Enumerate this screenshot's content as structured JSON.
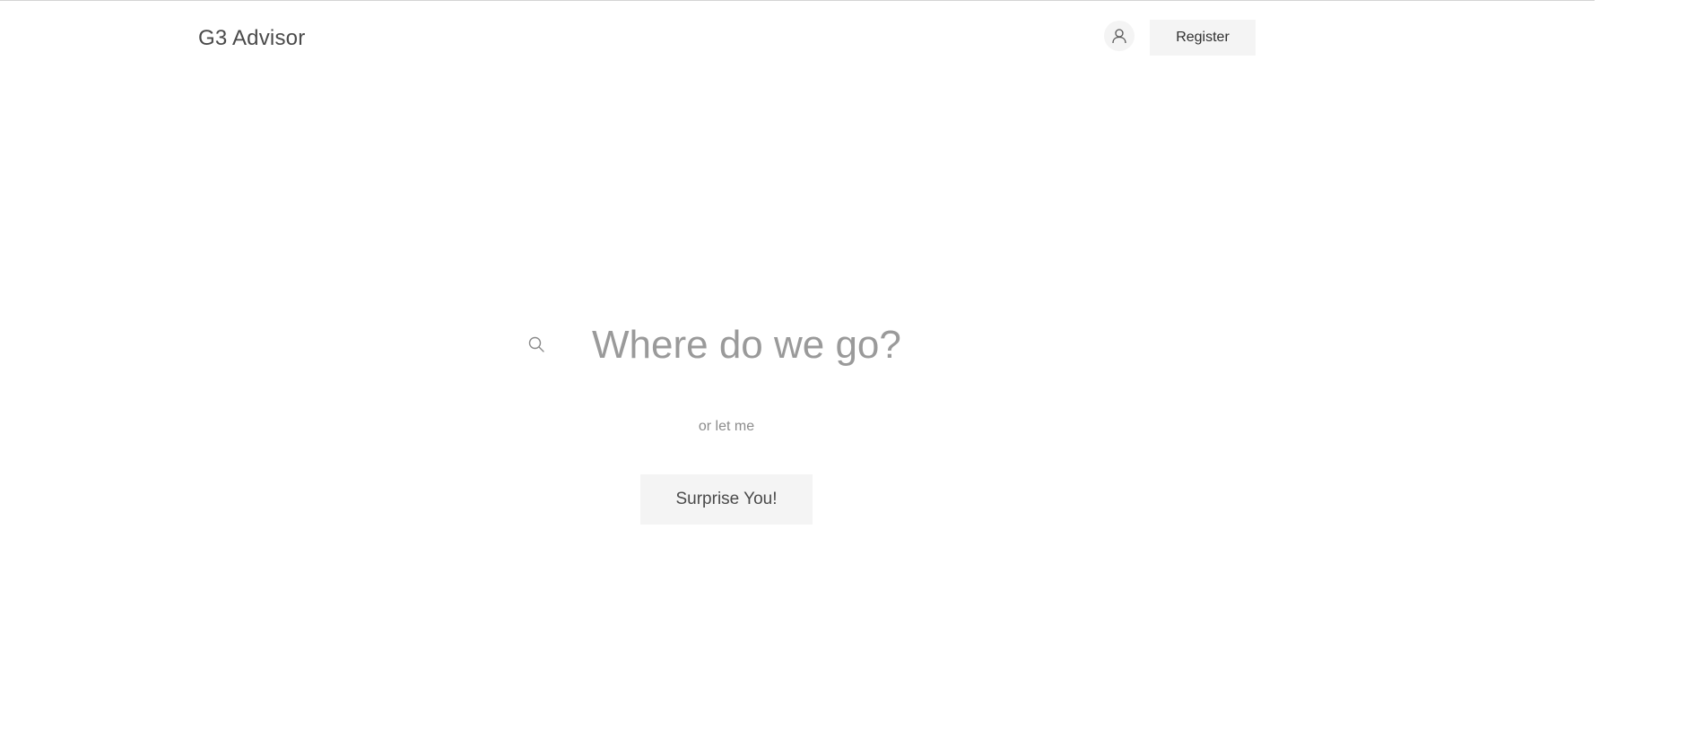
{
  "header": {
    "logo_text": "G3 Advisor",
    "avatar_icon": "user-icon",
    "register_label": "Register"
  },
  "search": {
    "icon": "search-icon",
    "placeholder": "Where do we go?",
    "value": ""
  },
  "alt_prompt": "or let me",
  "surprise_button_label": "Surprise You!",
  "colors": {
    "background": "#ffffff",
    "button_bg": "#f4f4f4",
    "text_dark": "#4a4a4a",
    "text_muted": "#8c8c8c",
    "placeholder": "#9a9a9a"
  }
}
